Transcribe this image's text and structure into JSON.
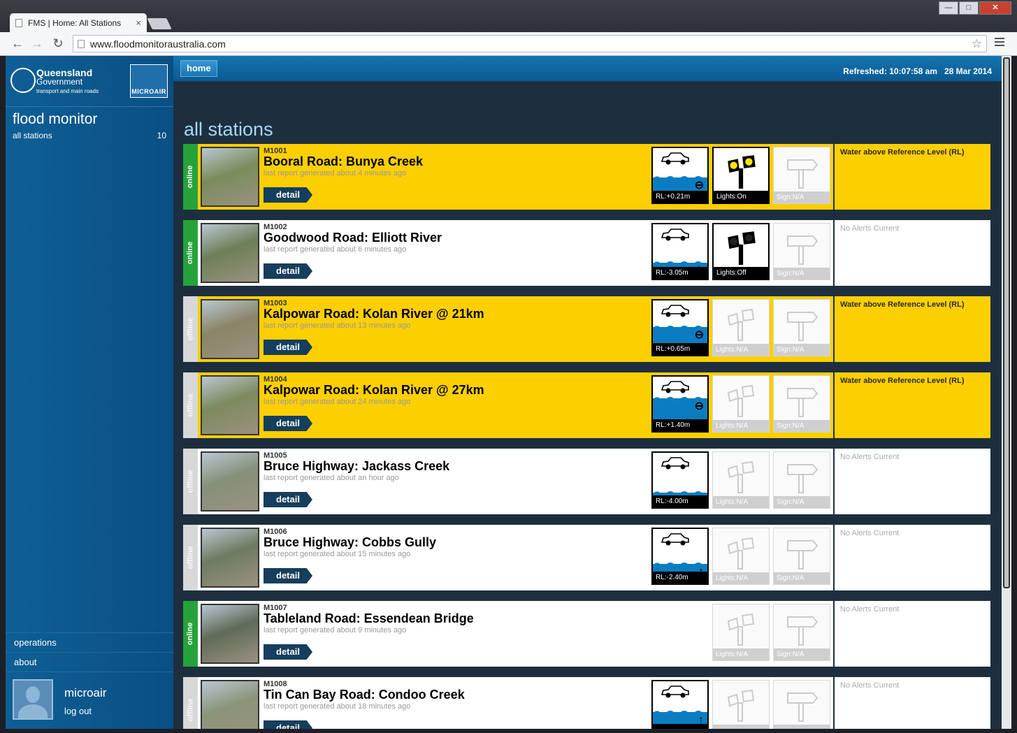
{
  "browser": {
    "tab_title": "FMS | Home: All Stations",
    "tab_close": "×",
    "url": "www.floodmonitoraustralia.com",
    "win_min": "—",
    "win_max": "□",
    "win_close": "✕"
  },
  "sidebar": {
    "org_line1": "Queensland",
    "org_line2": "Government",
    "org_line3": "transport and main roads",
    "partner_logo": "MICROAIR",
    "app_title": "flood monitor",
    "nav_label": "all stations",
    "nav_count": "10",
    "links": [
      "operations",
      "about"
    ],
    "user_name": "microair",
    "logout_label": "log out"
  },
  "header": {
    "home_label": "home",
    "refreshed_label": "Refreshed:",
    "refreshed_time": "10:07:58 am",
    "refreshed_date": "28 Mar 2014"
  },
  "page": {
    "heading": "all stations",
    "detail_label": "detail"
  },
  "stations": [
    {
      "id": "M1001",
      "name": "Booral Road: Bunya Creek",
      "report": "last report generated about 4 minutes ago",
      "status": "online",
      "theme": "yellow",
      "rl": "RL:+0.21m",
      "water_level": 0.45,
      "trend": "steady",
      "lights": "Lights:On",
      "lights_state": "on",
      "sign": "Sign:N/A",
      "alert": "Water above Reference Level (RL)",
      "photo_color": "#7a8c5c"
    },
    {
      "id": "M1002",
      "name": "Goodwood Road: Elliott River",
      "report": "last report generated about 6 minutes ago",
      "status": "online",
      "theme": "white",
      "rl": "RL:-3.05m",
      "water_level": 0.12,
      "trend": "steady",
      "lights": "Lights:Off",
      "lights_state": "off",
      "sign": "Sign:N/A",
      "alert": "No Alerts Current",
      "photo_color": "#6d7f58"
    },
    {
      "id": "M1003",
      "name": "Kalpowar Road: Kolan River @ 21km",
      "report": "last report generated about 13 minutes ago",
      "status": "offline",
      "theme": "yellow",
      "rl": "RL:+0.65m",
      "water_level": 0.55,
      "trend": "steady",
      "lights": "Lights:N/A",
      "lights_state": "na",
      "sign": "Sign:N/A",
      "alert": "Water above Reference Level (RL)",
      "photo_color": "#8a8468"
    },
    {
      "id": "M1004",
      "name": "Kalpowar Road: Kolan River @ 27km",
      "report": "last report generated about 24 minutes ago",
      "status": "offline",
      "theme": "yellow",
      "rl": "RL:+1.40m",
      "water_level": 0.72,
      "trend": "steady",
      "lights": "Lights:N/A",
      "lights_state": "na",
      "sign": "Sign:N/A",
      "alert": "Water above Reference Level (RL)",
      "photo_color": "#7d8a5e"
    },
    {
      "id": "M1005",
      "name": "Bruce Highway: Jackass Creek",
      "report": "last report generated about an hour ago",
      "status": "offline",
      "theme": "white",
      "rl": "RL:-4.00m",
      "water_level": 0.08,
      "trend": "steady",
      "lights": "Lights:N/A",
      "lights_state": "na",
      "sign": "Sign:N/A",
      "alert": "No Alerts Current",
      "photo_color": "#85907a"
    },
    {
      "id": "M1006",
      "name": "Bruce Highway: Cobbs Gully",
      "report": "last report generated about 15 minutes ago",
      "status": "offline",
      "theme": "white",
      "rl": "RL:-2.40m",
      "water_level": 0.25,
      "trend": "rising",
      "lights": "Lights:N/A",
      "lights_state": "na",
      "sign": "Sign:N/A",
      "alert": "No Alerts Current",
      "photo_color": "#6e7a62"
    },
    {
      "id": "M1007",
      "name": "Tableland Road: Essendean Bridge",
      "report": "last report generated about 9 minutes ago",
      "status": "online",
      "theme": "white",
      "rl": "",
      "water_level": 0,
      "trend": "none",
      "lights": "Lights:N/A",
      "lights_state": "na",
      "sign": "Sign:N/A",
      "alert": "No Alerts Current",
      "photo_color": "#5f6a58"
    },
    {
      "id": "M1008",
      "name": "Tin Can Bay Road: Condoo Creek",
      "report": "last report generated about 18 minutes ago",
      "status": "offline",
      "theme": "white",
      "rl": "",
      "water_level": 0.4,
      "trend": "rising",
      "lights": "",
      "lights_state": "na",
      "sign": "",
      "alert": "No Alerts Current",
      "photo_color": "#8a9478"
    }
  ],
  "colors": {
    "yellow": "#fccf00",
    "online": "#25a33a",
    "offline": "#d8d8d8",
    "water": "#0a7dc2",
    "navy": "#1d2f3f"
  }
}
